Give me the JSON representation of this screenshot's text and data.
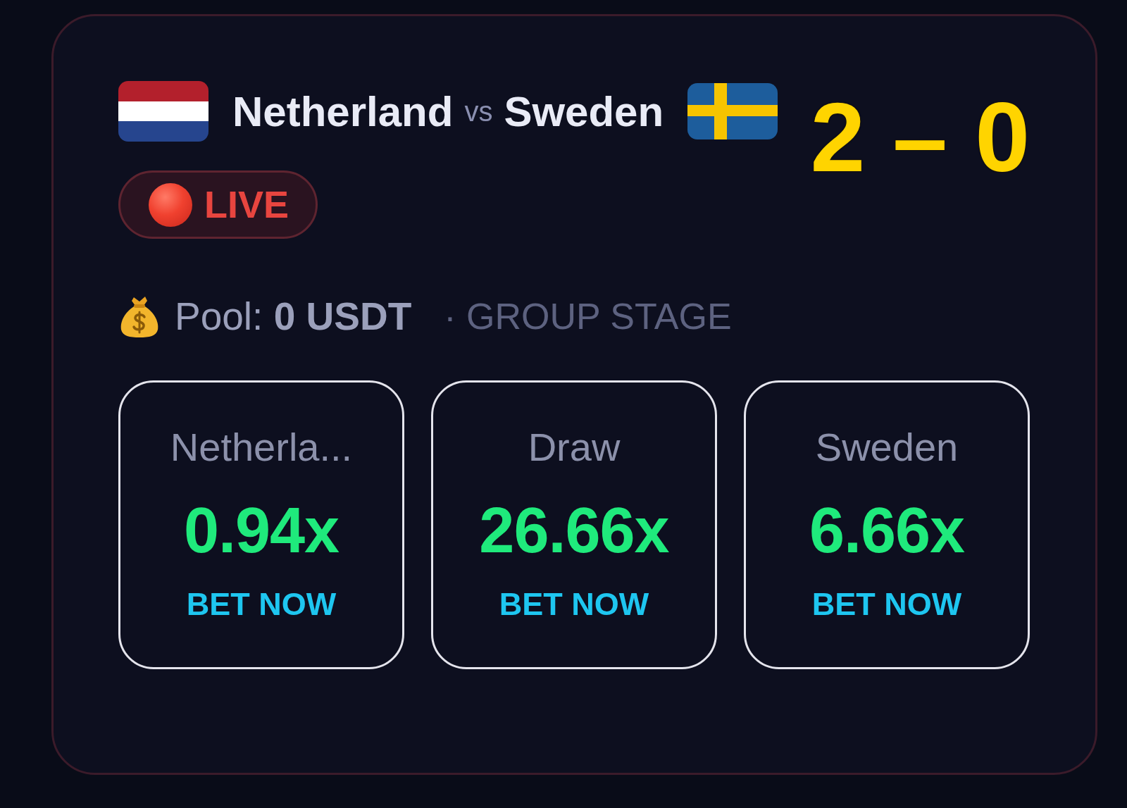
{
  "match": {
    "home_team": "Netherland",
    "versus": "vs",
    "away_team": "Sweden",
    "score": "2 – 0",
    "status": "LIVE"
  },
  "pool": {
    "text": "Pool: **0 USDT**",
    "stage": "· GROUP STAGE"
  },
  "bet_options": [
    {
      "label": "Netherla...",
      "odds": "0.94x",
      "action": "BET NOW"
    },
    {
      "label": "Draw",
      "odds": "26.66x",
      "action": "BET NOW"
    },
    {
      "label": "Sweden",
      "odds": "6.66x",
      "action": "BET NOW"
    }
  ]
}
